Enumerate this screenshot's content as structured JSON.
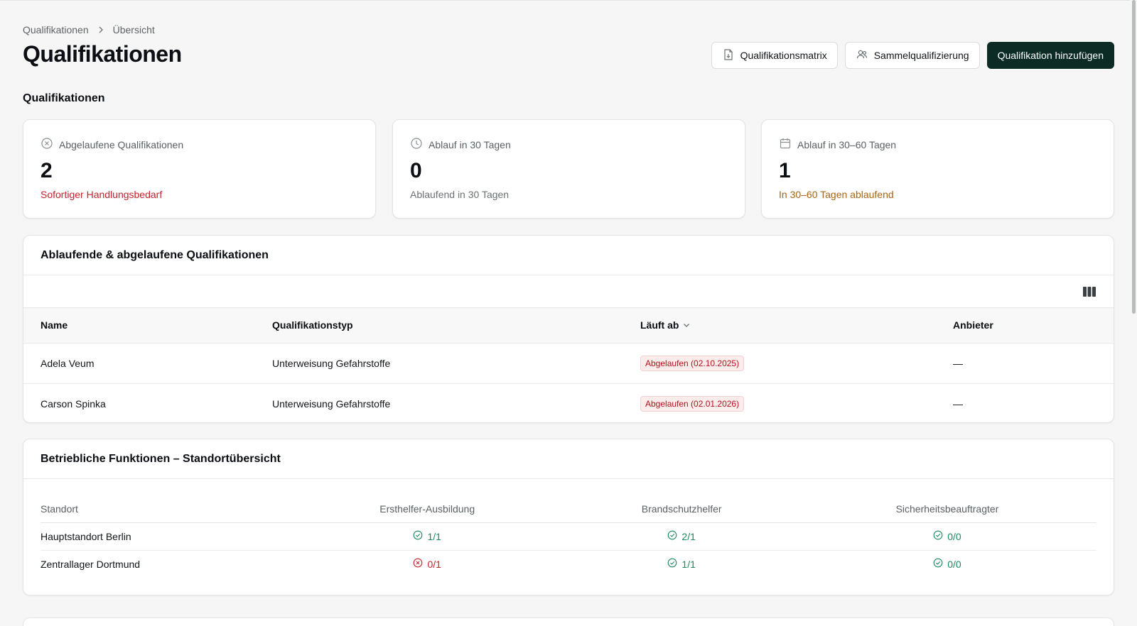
{
  "breadcrumb": {
    "root": "Qualifikationen",
    "current": "Übersicht"
  },
  "page_title": "Qualifikationen",
  "actions": {
    "matrix_label": "Qualifikationsmatrix",
    "bulk_label": "Sammelqualifizierung",
    "add_label": "Qualifikation hinzufügen"
  },
  "section_label": "Qualifikationen",
  "stats": [
    {
      "title": "Abgelaufene Qualifikationen",
      "value": "2",
      "subtitle": "Sofortiger Handlungsbedarf",
      "icon": "x-circle-icon",
      "subtitle_color": "#c8202a"
    },
    {
      "title": "Ablauf in 30 Tagen",
      "value": "0",
      "subtitle": "Ablaufend in 30 Tagen",
      "icon": "clock-icon",
      "subtitle_color": "#6b7174"
    },
    {
      "title": "Ablauf in 30–60 Tagen",
      "value": "1",
      "subtitle": "In 30–60 Tagen ablaufend",
      "icon": "calendar-icon",
      "subtitle_color": "#a86414"
    }
  ],
  "expiring": {
    "title": "Ablaufende & abgelaufene Qualifikationen",
    "columns": [
      "Name",
      "Qualifikationstyp",
      "Läuft ab",
      "Anbieter"
    ],
    "rows": [
      {
        "name": "Adela Veum",
        "type": "Unterweisung Gefahrstoffe",
        "expires": "Abgelaufen (02.10.2025)",
        "provider": "—"
      },
      {
        "name": "Carson Spinka",
        "type": "Unterweisung Gefahrstoffe",
        "expires": "Abgelaufen (02.01.2026)",
        "provider": "—"
      }
    ]
  },
  "functions": {
    "title": "Betriebliche Funktionen – Standortübersicht",
    "columns": [
      "Standort",
      "Ersthelfer-Ausbildung",
      "Brandschutzhelfer",
      "Sicherheitsbeauftragter"
    ],
    "rows": [
      {
        "site": "Hauptstandort Berlin",
        "first_aid": "1/1",
        "fire": "2/1",
        "safety": "0/0"
      },
      {
        "site": "Zentrallager Dortmund",
        "first_aid": "0/1",
        "fire": "1/1",
        "safety": "0/0"
      }
    ]
  },
  "colors": {
    "primary": "#0c2b24",
    "danger": "#c8202a",
    "success": "#1c8a5e",
    "warning": "#a86414"
  }
}
